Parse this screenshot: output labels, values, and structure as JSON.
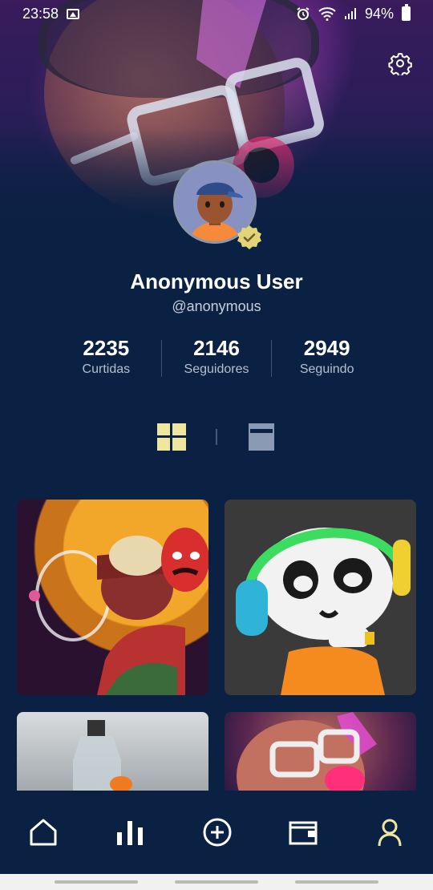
{
  "status_bar": {
    "time": "23:58",
    "battery": "94%"
  },
  "profile": {
    "name": "Anonymous User",
    "handle": "@anonymous",
    "verified": true
  },
  "stats": [
    {
      "value": "2235",
      "label": "Curtidas"
    },
    {
      "value": "2146",
      "label": "Seguidores"
    },
    {
      "value": "2949",
      "label": "Seguindo"
    }
  ],
  "view_toggle": {
    "active": "grid",
    "active_color": "#efe6a0",
    "inactive_color": "#8a99b4"
  },
  "bottom_nav": {
    "items": [
      "home-icon",
      "stats-icon",
      "add-circle-icon",
      "wallet-icon",
      "profile-icon"
    ],
    "active": "profile-icon",
    "active_color": "#efe6a0"
  },
  "colors": {
    "background": "#0b2143",
    "accent": "#efe6a0"
  }
}
